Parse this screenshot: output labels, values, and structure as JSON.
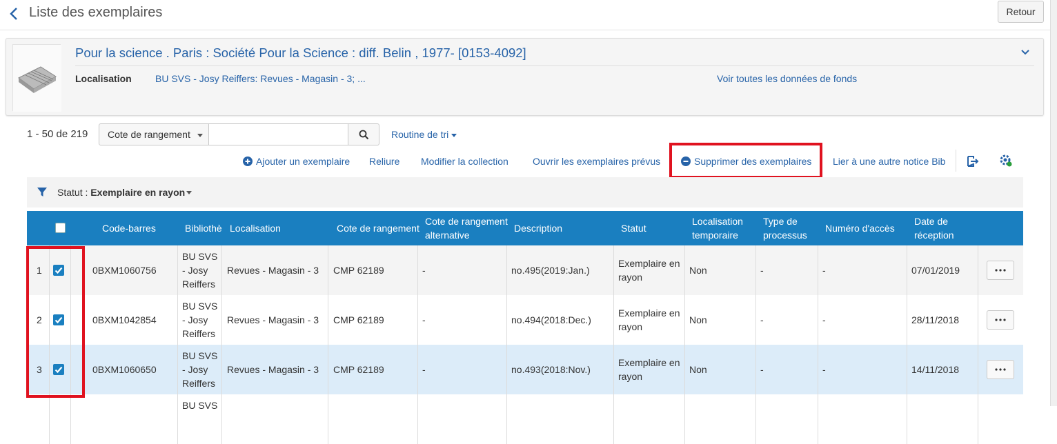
{
  "header": {
    "title": "Liste des exemplaires",
    "back_button": "Retour"
  },
  "record": {
    "title": "Pour la science . Paris : Société Pour la Science : diff. Belin , 1977- [0153-4092]",
    "location_label": "Localisation",
    "location_value": "BU SVS - Josy Reiffers: Revues - Magasin - 3; ...",
    "holdings_link": "Voir toutes les données de fonds"
  },
  "toolbar": {
    "pager": "1 - 50 de 219",
    "search_scope": "Cote de rangement",
    "search_value": "",
    "sort_label": "Routine de tri",
    "actions": [
      "Ajouter un exemplaire",
      "Reliure",
      "Modifier la collection",
      "Ouvrir les exemplaires prévus",
      "Supprimer des exemplaires",
      "Lier à une autre notice Bib"
    ]
  },
  "filter": {
    "label": "Statut :",
    "value": "Exemplaire en rayon"
  },
  "colors": {
    "accent": "#1a7fc0",
    "link": "#2763a8",
    "highlight": "#e0121f",
    "selected_row": "#dcecf9"
  },
  "table": {
    "columns": [
      "Code-barres",
      "Bibliothè",
      "Localisation",
      "Cote de rangement",
      "Cote de rangement alternative",
      "Description",
      "Statut",
      "Localisation temporaire",
      "Type de processus",
      "Numéro d'accès",
      "Date de réception"
    ],
    "rows": [
      {
        "num": "1",
        "checked": true,
        "barcode": "0BXM1060756",
        "library": "BU SVS - Josy Reiffers",
        "location": "Revues - Magasin - 3",
        "callnum": "CMP 62189",
        "alt_callnum": "-",
        "description": "no.495(2019:Jan.)",
        "status": "Exemplaire en rayon",
        "temp_location": "Non",
        "process_type": "-",
        "accession": "-",
        "receipt_date": "07/01/2019"
      },
      {
        "num": "2",
        "checked": true,
        "barcode": "0BXM1042854",
        "library": "BU SVS - Josy Reiffers",
        "location": "Revues - Magasin - 3",
        "callnum": "CMP 62189",
        "alt_callnum": "-",
        "description": "no.494(2018:Dec.)",
        "status": "Exemplaire en rayon",
        "temp_location": "Non",
        "process_type": "-",
        "accession": "-",
        "receipt_date": "28/11/2018"
      },
      {
        "num": "3",
        "checked": true,
        "barcode": "0BXM1060650",
        "library": "BU SVS - Josy Reiffers",
        "location": "Revues - Magasin - 3",
        "callnum": "CMP 62189",
        "alt_callnum": "-",
        "description": "no.493(2018:Nov.)",
        "status": "Exemplaire en rayon",
        "temp_location": "Non",
        "process_type": "-",
        "accession": "-",
        "receipt_date": "14/11/2018"
      },
      {
        "num": "",
        "checked": false,
        "barcode": "",
        "library": "BU SVS",
        "location": "",
        "callnum": "",
        "alt_callnum": "",
        "description": "",
        "status": "",
        "temp_location": "",
        "process_type": "",
        "accession": "",
        "receipt_date": ""
      }
    ]
  }
}
